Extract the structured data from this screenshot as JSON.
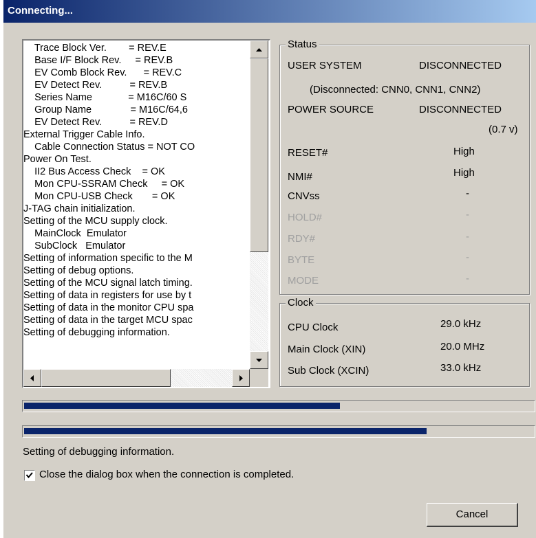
{
  "window": {
    "title": "Connecting..."
  },
  "log": {
    "lines": [
      "    Trace Block Ver.        = REV.E",
      "    Base I/F Block Rev.     = REV.B",
      "    EV Comb Block Rev.      = REV.C",
      "    EV Detect Rev.          = REV.B",
      "    Series Name             = M16C/60 S",
      "    Group Name              = M16C/64,6",
      "    EV Detect Rev.          = REV.D",
      "External Trigger Cable Info.",
      "    Cable Connection Status = NOT CO",
      "Power On Test.",
      "    II2 Bus Access Check    = OK",
      "    Mon CPU-SSRAM Check     = OK",
      "    Mon CPU-USB Check       = OK",
      "J-TAG chain initialization.",
      "Setting of the MCU supply clock.",
      "    MainClock  Emulator",
      "    SubClock   Emulator",
      "Setting of information specific to the M",
      "Setting of debug options.",
      "Setting of the MCU signal latch timing.",
      "Setting of data in registers for use by t",
      "Setting of data in the monitor CPU spa",
      "Setting of data in the target MCU spac",
      "Setting of debugging information."
    ]
  },
  "status": {
    "legend": "Status",
    "user_system_label": "USER SYSTEM",
    "user_system_value": "DISCONNECTED",
    "user_system_detail": "(Disconnected: CNN0, CNN1, CNN2)",
    "power_source_label": "POWER SOURCE",
    "power_source_value": "DISCONNECTED",
    "power_source_voltage": "(0.7 v)",
    "rows": [
      {
        "label": "RESET#",
        "value": "High"
      },
      {
        "label": "NMI#",
        "value": "High"
      },
      {
        "label": "CNVss",
        "value": "-"
      },
      {
        "label": "HOLD#",
        "value": "-"
      },
      {
        "label": "RDY#",
        "value": "-"
      },
      {
        "label": "BYTE",
        "value": "-"
      },
      {
        "label": "MODE",
        "value": "-"
      }
    ]
  },
  "clock": {
    "legend": "Clock",
    "rows": [
      {
        "label": "CPU Clock",
        "value": "29.0 kHz"
      },
      {
        "label": "Main Clock (XIN)",
        "value": "20.0 MHz"
      },
      {
        "label": "Sub Clock  (XCIN)",
        "value": "33.0 kHz"
      }
    ]
  },
  "progress": {
    "primary": 0.62,
    "secondary": 0.79
  },
  "status_message": "Setting of debugging information.",
  "close_checkbox": {
    "label": "Close the dialog box when the connection is completed.",
    "checked": true
  },
  "cancel_label": "Cancel"
}
